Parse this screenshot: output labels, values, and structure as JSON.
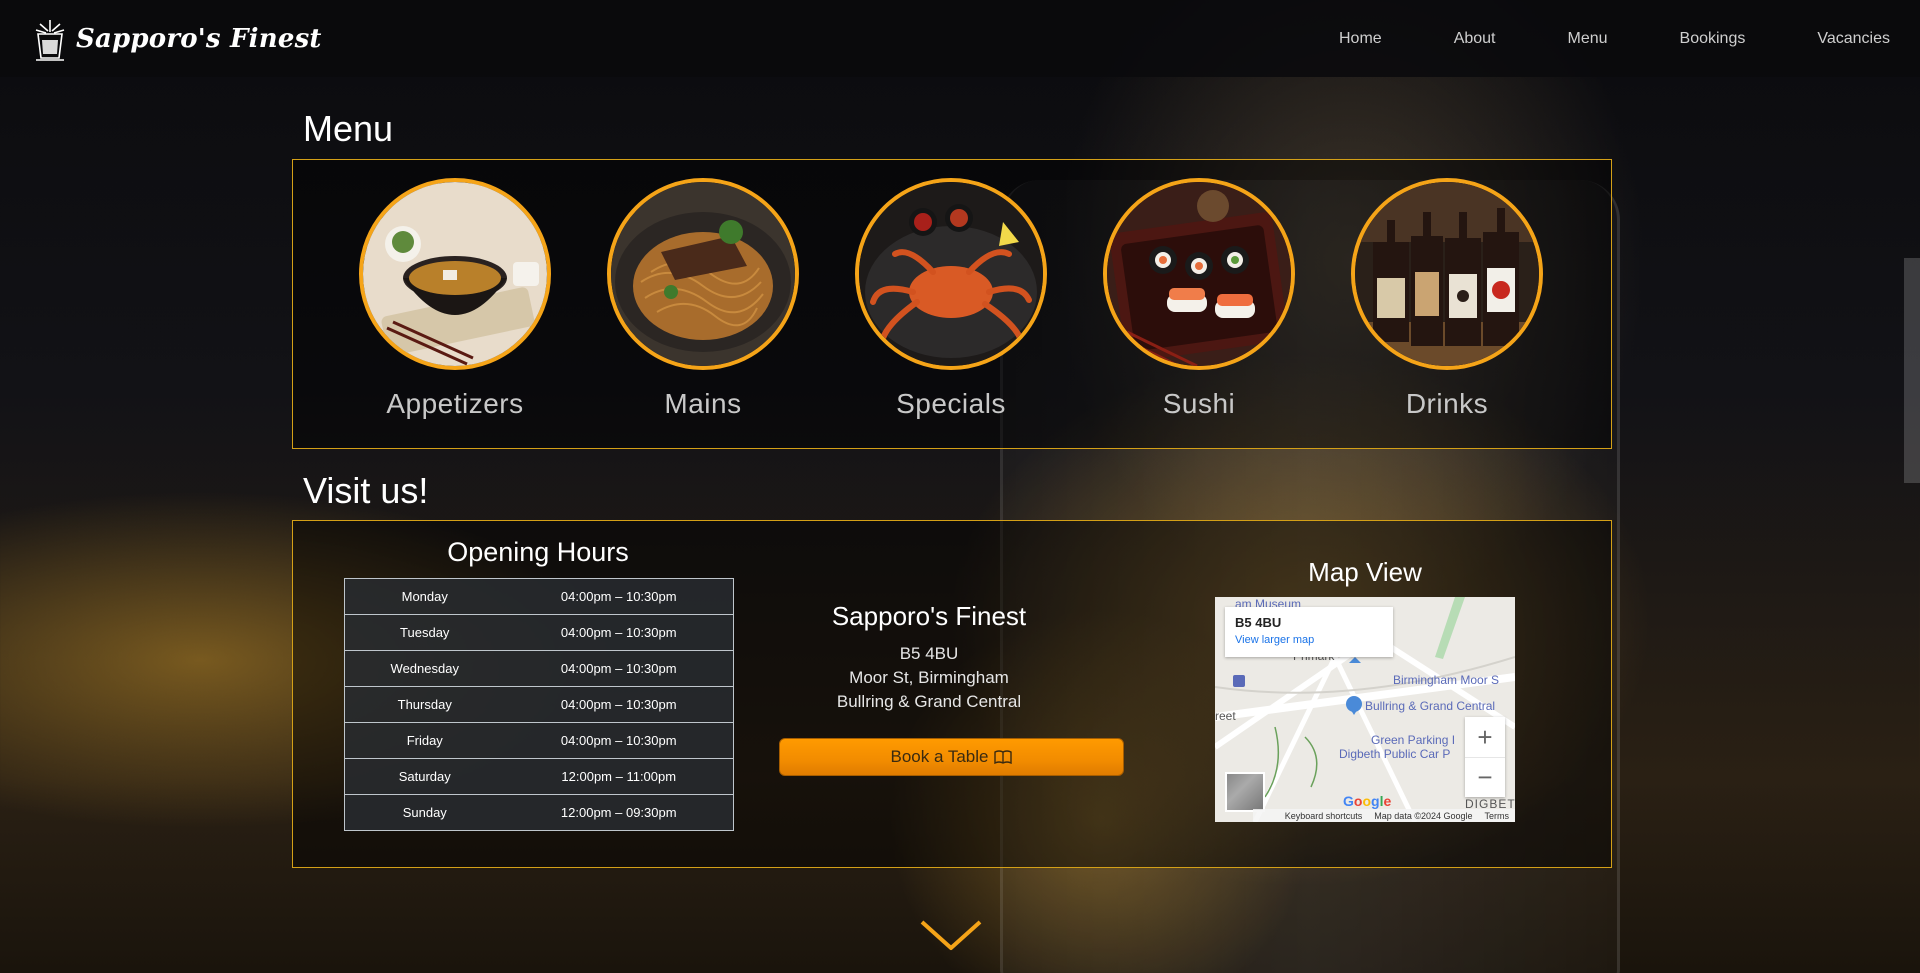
{
  "brand": {
    "name": "Sapporo's Finest",
    "logo_icon": "sake-glass-icon"
  },
  "nav": {
    "items": [
      {
        "label": "Home"
      },
      {
        "label": "About"
      },
      {
        "label": "Menu"
      },
      {
        "label": "Bookings"
      },
      {
        "label": "Vacancies"
      }
    ]
  },
  "menu_section": {
    "title": "Menu",
    "cards": [
      {
        "label": "Appetizers",
        "image": "miso-soup-image"
      },
      {
        "label": "Mains",
        "image": "noodles-image"
      },
      {
        "label": "Specials",
        "image": "crab-image"
      },
      {
        "label": "Sushi",
        "image": "sushi-platter-image"
      },
      {
        "label": "Drinks",
        "image": "sake-bottles-image"
      }
    ]
  },
  "visit_section": {
    "title": "Visit us!",
    "hours_title": "Opening Hours",
    "hours": [
      {
        "day": "Monday",
        "time": "04:00pm – 10:30pm"
      },
      {
        "day": "Tuesday",
        "time": "04:00pm – 10:30pm"
      },
      {
        "day": "Wednesday",
        "time": "04:00pm – 10:30pm"
      },
      {
        "day": "Thursday",
        "time": "04:00pm – 10:30pm"
      },
      {
        "day": "Friday",
        "time": "04:00pm – 10:30pm"
      },
      {
        "day": "Saturday",
        "time": "12:00pm – 11:00pm"
      },
      {
        "day": "Sunday",
        "time": "12:00pm – 09:30pm"
      }
    ],
    "address": {
      "name": "Sapporo's Finest",
      "postcode": "B5 4BU",
      "street": "Moor St, Birmingham",
      "area": "Bullring & Grand Central"
    },
    "book_button": "Book a Table",
    "map": {
      "title": "Map View",
      "card_title": "B5 4BU",
      "card_link": "View larger map",
      "labels": {
        "museum": "am Museum",
        "station1": "Birmingham Moor S",
        "station2": "Bullring & Grand Central",
        "street": "reet",
        "parking1": "Green Parking I",
        "parking2": "Digbeth Public Car P",
        "district": "DIGBET",
        "primark": "Primark"
      },
      "zoom_in": "+",
      "zoom_out": "−",
      "google": "Google",
      "footer": {
        "shortcuts": "Keyboard shortcuts",
        "data": "Map data ©2024 Google",
        "terms": "Terms"
      }
    }
  },
  "colors": {
    "accent": "#f5a418",
    "panel_border": "#d4a017",
    "button": "#ff9a00"
  }
}
